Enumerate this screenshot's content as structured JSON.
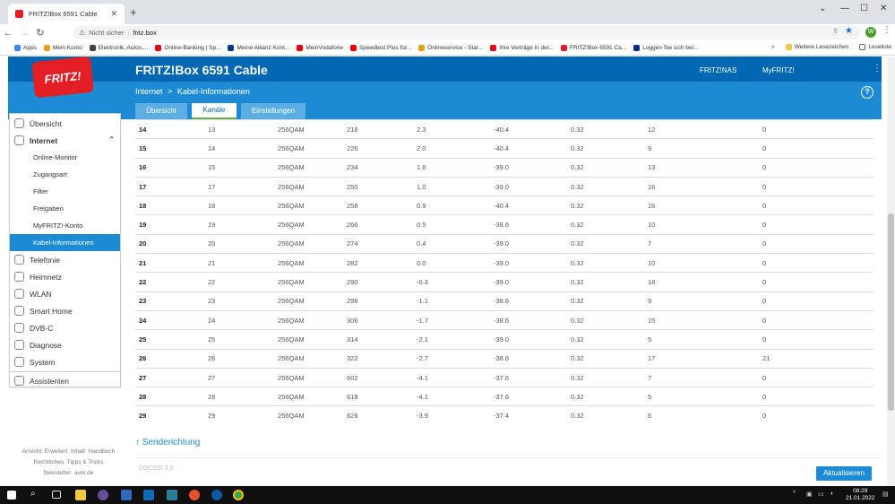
{
  "browser": {
    "tab_title": "FRITZ!Box 6591 Cable",
    "tab_close": "✕",
    "new_tab": "+",
    "not_secure": "Nicht sicher",
    "url": "fritz.box",
    "avatar_letter": "W",
    "bookmarks": [
      {
        "label": "Apps",
        "color": "#4285f4"
      },
      {
        "label": "Mein Konto",
        "color": "#e4a11b"
      },
      {
        "label": "Elektronik, Autos,...",
        "color": "#444444"
      },
      {
        "label": "Online-Banking | Sp...",
        "color": "#e30613"
      },
      {
        "label": "Meine Allianz Kont...",
        "color": "#003781"
      },
      {
        "label": "MeinVodafone",
        "color": "#e60000"
      },
      {
        "label": "Speedtest Plus für...",
        "color": "#e60000"
      },
      {
        "label": "Onlineservice - Star...",
        "color": "#e4a11b"
      },
      {
        "label": "Ihre Verträge in der...",
        "color": "#e50914"
      },
      {
        "label": "FRITZ!Box 6591 Ca...",
        "color": "#e31e24"
      },
      {
        "label": "Loggen Sie sich bei...",
        "color": "#003087"
      }
    ],
    "bookmarks_more": "»",
    "other_bookmarks": "Weitere Lesezeichen",
    "reading_list": "Leseliste"
  },
  "app": {
    "logo_text": "FRITZ!",
    "title": "FRITZ!Box 6591 Cable",
    "header_links": [
      "FRITZ!NAS",
      "MyFRITZ!"
    ],
    "breadcrumb": [
      "Internet",
      "Kabel-Informationen"
    ],
    "breadcrumb_sep": ">",
    "help": "?",
    "page_tabs": [
      "Übersicht",
      "Kanäle",
      "Einstellungen"
    ],
    "active_tab": 1,
    "sidebar": [
      {
        "label": "Übersicht",
        "level": 0,
        "icon": "home-icon"
      },
      {
        "label": "Internet",
        "level": 0,
        "icon": "globe-icon",
        "bold": true
      },
      {
        "label": "Online-Monitor",
        "level": 1
      },
      {
        "label": "Zugangsart",
        "level": 1
      },
      {
        "label": "Filter",
        "level": 1
      },
      {
        "label": "Freigaben",
        "level": 1
      },
      {
        "label": "MyFRITZ!-Konto",
        "level": 1
      },
      {
        "label": "Kabel-Informationen",
        "level": 1,
        "active": true
      },
      {
        "label": "Telefonie",
        "level": 0,
        "icon": "phone-icon"
      },
      {
        "label": "Heimnetz",
        "level": 0,
        "icon": "network-icon"
      },
      {
        "label": "WLAN",
        "level": 0,
        "icon": "wifi-icon"
      },
      {
        "label": "Smart Home",
        "level": 0,
        "icon": "smart-home-icon"
      },
      {
        "label": "DVB-C",
        "level": 0,
        "icon": "tv-icon"
      },
      {
        "label": "Diagnose",
        "level": 0,
        "icon": "diagnose-icon"
      },
      {
        "label": "System",
        "level": 0,
        "icon": "system-icon"
      },
      {
        "label": "Assistenten",
        "level": 0,
        "icon": "assistant-icon"
      }
    ],
    "sidebar_footer": {
      "line1": [
        "Ansicht: Erweitert",
        "Inhalt",
        "Handbuch"
      ],
      "line2": [
        "Rechtliches",
        "Tipps & Tricks"
      ],
      "line3": [
        "Newsletter",
        "avm.de"
      ]
    },
    "channels": [
      [
        "14",
        "13",
        "256QAM",
        "218",
        "2.3",
        "-40.4",
        "0.32",
        "12",
        "0"
      ],
      [
        "15",
        "14",
        "256QAM",
        "226",
        "2.0",
        "-40.4",
        "0.32",
        "9",
        "0"
      ],
      [
        "16",
        "15",
        "256QAM",
        "234",
        "1.6",
        "-39.0",
        "0.32",
        "13",
        "0"
      ],
      [
        "17",
        "17",
        "256QAM",
        "250",
        "1.0",
        "-39.0",
        "0.32",
        "16",
        "0"
      ],
      [
        "18",
        "18",
        "256QAM",
        "258",
        "0.9",
        "-40.4",
        "0.32",
        "16",
        "0"
      ],
      [
        "19",
        "19",
        "256QAM",
        "266",
        "0.5",
        "-38.6",
        "0.32",
        "10",
        "0"
      ],
      [
        "20",
        "20",
        "256QAM",
        "274",
        "0.4",
        "-39.0",
        "0.32",
        "7",
        "0"
      ],
      [
        "21",
        "21",
        "256QAM",
        "282",
        "0.0",
        "-39.0",
        "0.32",
        "10",
        "0"
      ],
      [
        "22",
        "22",
        "256QAM",
        "290",
        "-0.3",
        "-39.0",
        "0.32",
        "18",
        "0"
      ],
      [
        "23",
        "23",
        "256QAM",
        "298",
        "-1.1",
        "-38.6",
        "0.32",
        "9",
        "0"
      ],
      [
        "24",
        "24",
        "256QAM",
        "306",
        "-1.7",
        "-38.6",
        "0.32",
        "15",
        "0"
      ],
      [
        "25",
        "25",
        "256QAM",
        "314",
        "-2.1",
        "-39.0",
        "0.32",
        "5",
        "0"
      ],
      [
        "26",
        "26",
        "256QAM",
        "322",
        "-2.7",
        "-38.6",
        "0.32",
        "17",
        "21"
      ],
      [
        "27",
        "27",
        "256QAM",
        "602",
        "-4.1",
        "-37.6",
        "0.32",
        "7",
        "0"
      ],
      [
        "28",
        "28",
        "256QAM",
        "618",
        "-4.1",
        "-37.6",
        "0.32",
        "5",
        "0"
      ],
      [
        "29",
        "29",
        "256QAM",
        "626",
        "-3.9",
        "-37.4",
        "0.32",
        "6",
        "0"
      ]
    ],
    "section_link": "↑ Senderichtung",
    "docsis_label": "DOCSIS 3.0",
    "apply_button": "Aktualisieren"
  },
  "taskbar": {
    "time": "08:29",
    "date": "21.01.2022"
  }
}
